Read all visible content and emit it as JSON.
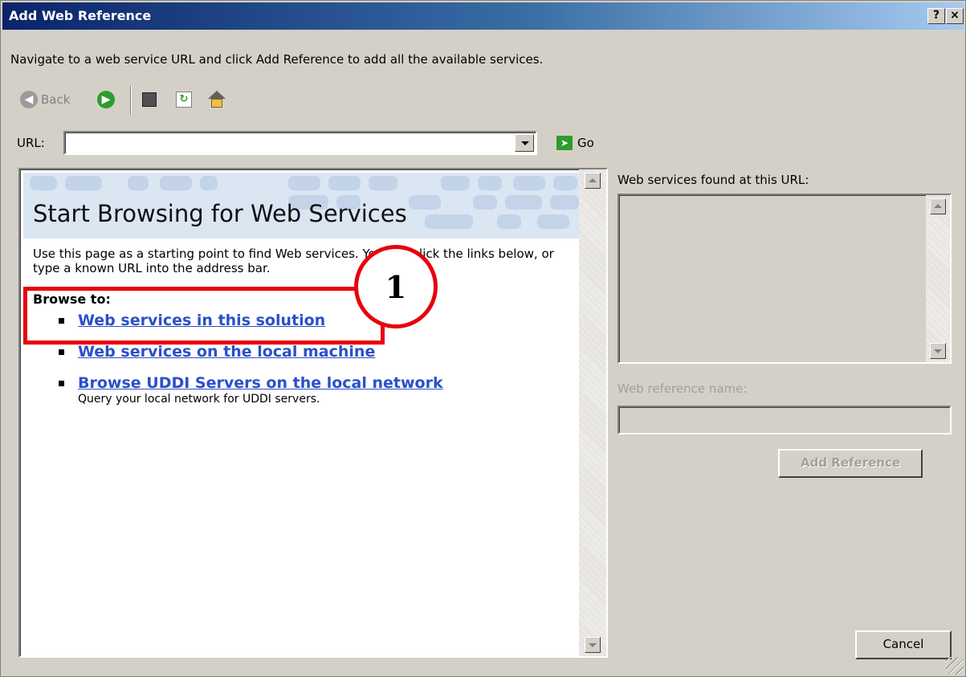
{
  "window": {
    "title": "Add Web Reference",
    "help_button": "?",
    "close_button": "×"
  },
  "instruction": "Navigate to a web service URL and click Add Reference to add all the available services.",
  "toolbar": {
    "back_label": "Back",
    "icons": [
      "back-icon",
      "forward-icon",
      "stop-icon",
      "refresh-icon",
      "home-icon"
    ]
  },
  "url_bar": {
    "label": "URL:",
    "value": "",
    "go_label": "Go"
  },
  "browser": {
    "banner_title": "Start Browsing for Web Services",
    "intro": "Use this page as a starting point to find Web services. You can click the links below, or type a known URL into the address bar.",
    "browse_to_label": "Browse to:",
    "links": [
      {
        "label": "Web services in this solution",
        "description": ""
      },
      {
        "label": "Web services on the local machine",
        "description": ""
      },
      {
        "label": "Browse UDDI Servers on the local network",
        "description": "Query your local network for UDDI servers."
      }
    ]
  },
  "annotation": {
    "step_number": "1",
    "color": "#e8000c"
  },
  "right_panel": {
    "found_label": "Web services found at this URL:",
    "reference_name_label": "Web reference name:",
    "reference_name_value": "",
    "add_reference_button": "Add Reference",
    "cancel_button": "Cancel"
  },
  "colors": {
    "dialog_bg": "#d4d0c8",
    "title_bar_start": "#0a246a",
    "link_color": "#2b50c8"
  }
}
